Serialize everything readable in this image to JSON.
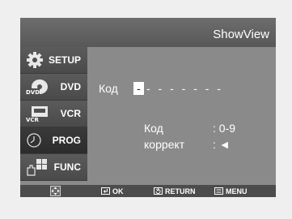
{
  "header": {
    "title": "ShowView"
  },
  "sidebar": {
    "items": [
      {
        "label": "SETUP",
        "icon": "gear-icon"
      },
      {
        "label": "DVD",
        "icon": "dvd-disc-icon"
      },
      {
        "label": "VCR",
        "icon": "vcr-cassette-icon"
      },
      {
        "label": "PROG",
        "icon": "clock-icon",
        "selected": true
      },
      {
        "label": "FUNC",
        "icon": "hand-grid-icon"
      }
    ]
  },
  "main": {
    "code_label": "Код",
    "code_first": "-",
    "code_rest": "- - - - - - -",
    "hints": [
      {
        "label": "Код",
        "value": ": 0-9"
      },
      {
        "label": "коррект",
        "value": ": ◄"
      }
    ]
  },
  "footer": {
    "ok_label": "OK",
    "return_label": "RETURN",
    "menu_label": "MENU",
    "nav_icon": "dpad-icon"
  }
}
